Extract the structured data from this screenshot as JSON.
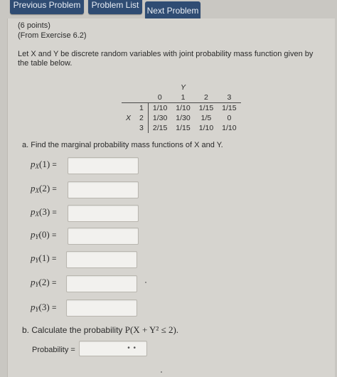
{
  "nav": {
    "prev_label": "Previous Problem",
    "list_label": "Problem List",
    "next_label": "Next Problem"
  },
  "problem": {
    "points": "(6 points)",
    "from": "(From Exercise 6.2)",
    "intro": "Let X and Y be discrete random variables with joint probability mass function given by the table below."
  },
  "pmf_table": {
    "y_label": "Y",
    "x_label": "X",
    "y_values": [
      "0",
      "1",
      "2",
      "3"
    ],
    "rows": [
      {
        "x": "1",
        "cells": [
          "1/10",
          "1/10",
          "1/15",
          "1/15"
        ]
      },
      {
        "x": "2",
        "cells": [
          "1/30",
          "1/30",
          "1/5",
          "0"
        ]
      },
      {
        "x": "3",
        "cells": [
          "2/15",
          "1/15",
          "1/10",
          "1/10"
        ]
      }
    ]
  },
  "part_a": {
    "text": "a. Find the marginal probability mass functions of X and Y.",
    "questions": [
      {
        "fn": "p",
        "sub": "X",
        "arg": "(1)",
        "eq": "=",
        "value": ""
      },
      {
        "fn": "p",
        "sub": "X",
        "arg": "(2)",
        "eq": "=",
        "value": ""
      },
      {
        "fn": "p",
        "sub": "X",
        "arg": "(3)",
        "eq": "=",
        "value": ""
      },
      {
        "fn": "p",
        "sub": "Y",
        "arg": "(0)",
        "eq": "=",
        "value": ""
      },
      {
        "fn": "p",
        "sub": "Y",
        "arg": "(1)",
        "eq": "=",
        "value": ""
      },
      {
        "fn": "p",
        "sub": "Y",
        "arg": "(2)",
        "eq": "=",
        "value": ""
      },
      {
        "fn": "p",
        "sub": "Y",
        "arg": "(3)",
        "eq": "=",
        "value": ""
      }
    ]
  },
  "part_b": {
    "text": "b. Calculate the probability ",
    "math": "P(X + Y² ≤ 2).",
    "prob_label": "Probability =",
    "prob_value": "",
    "hint": "• •"
  }
}
